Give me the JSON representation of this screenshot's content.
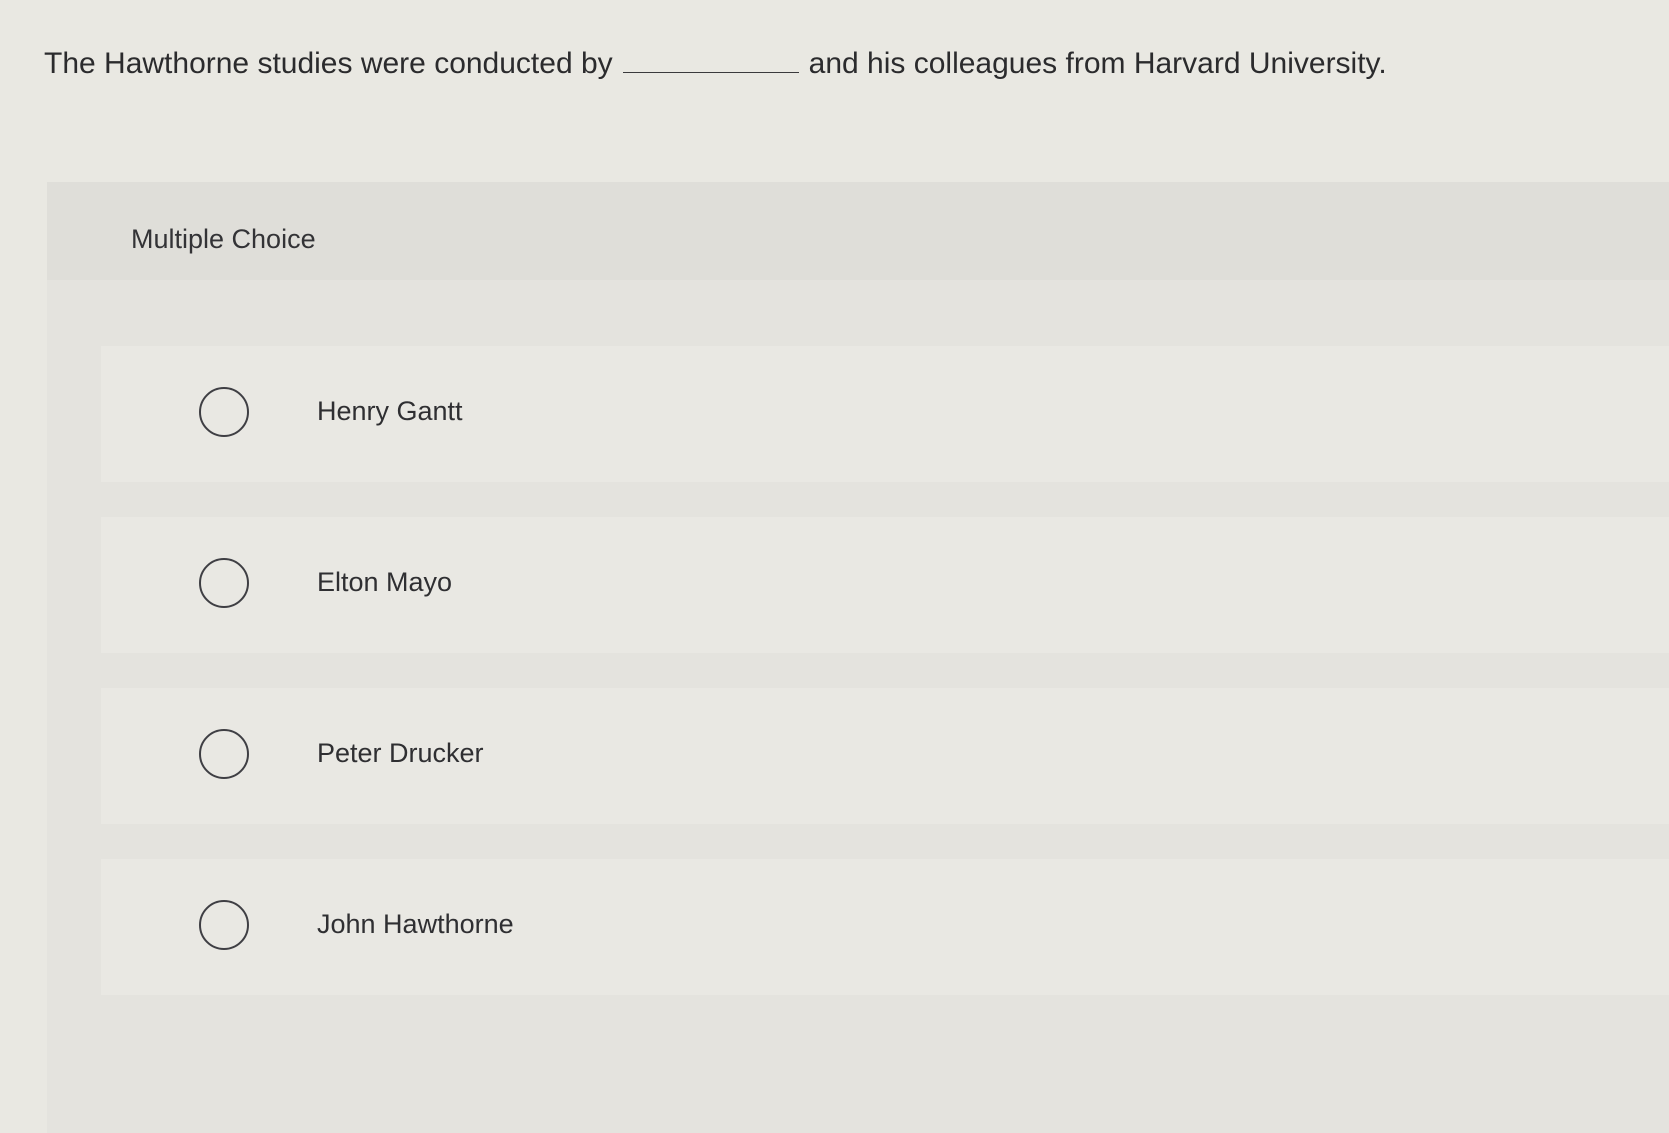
{
  "question": {
    "prefix": "The Hawthorne studies were conducted by",
    "suffix": "and his colleagues from Harvard University."
  },
  "panel": {
    "label": "Multiple Choice"
  },
  "options": [
    {
      "label": "Henry Gantt",
      "selected": false
    },
    {
      "label": "Elton Mayo",
      "selected": false
    },
    {
      "label": "Peter Drucker",
      "selected": false
    },
    {
      "label": "John Hawthorne",
      "selected": false
    }
  ]
}
